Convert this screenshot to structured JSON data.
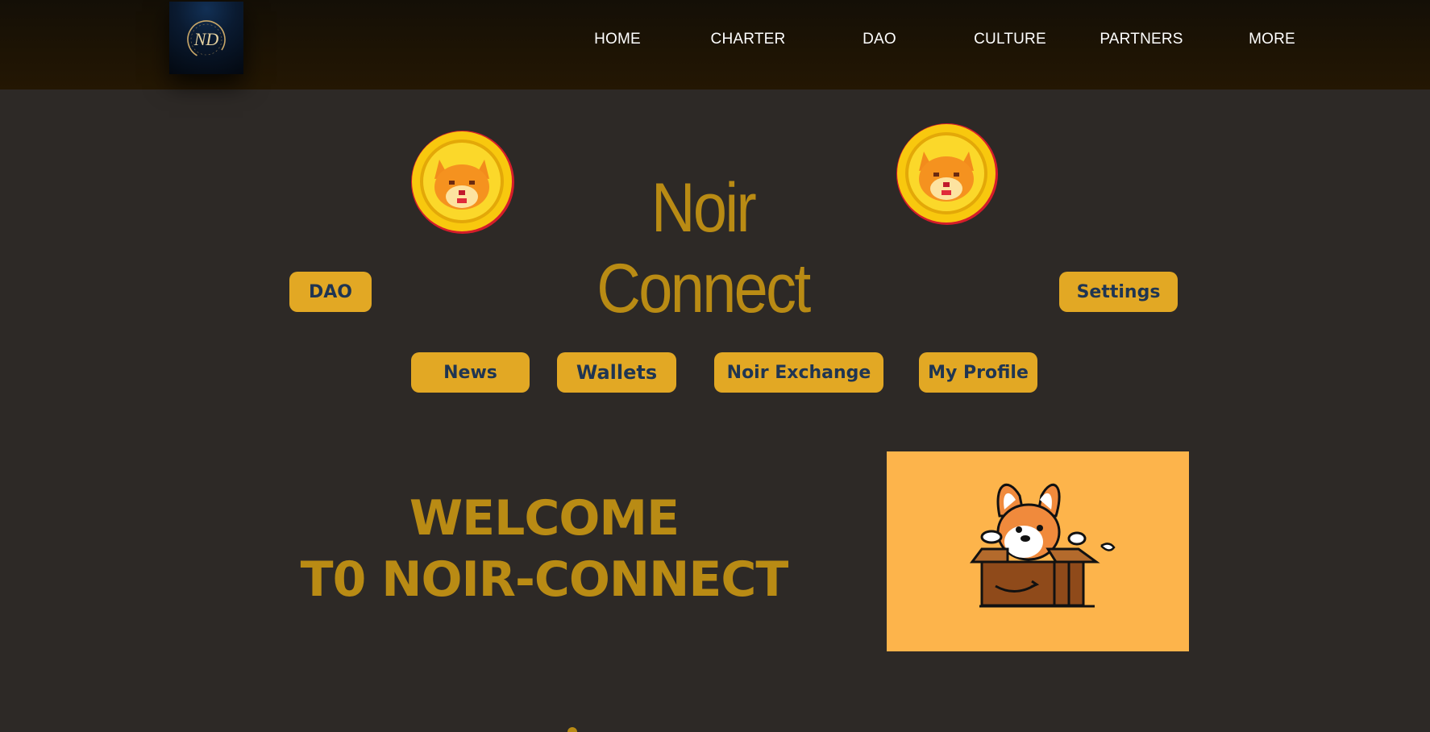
{
  "header": {
    "logo_text": "ND",
    "nav": [
      {
        "label": "HOME"
      },
      {
        "label": "CHARTER"
      },
      {
        "label": "DAO"
      },
      {
        "label": "CULTURE"
      },
      {
        "label": "PARTNERS"
      },
      {
        "label": "MORE"
      }
    ]
  },
  "hero": {
    "title": "Noir Connect",
    "coin_icon": "shiba-coin-icon"
  },
  "buttons": {
    "dao": "DAO",
    "settings": "Settings",
    "news": "News",
    "wallets": "Wallets",
    "noir_exchange": "Noir Exchange",
    "my_profile": "My Profile"
  },
  "welcome": {
    "line1": "WELCOME",
    "line2": "T0 NOIR-CONNECT"
  },
  "image": {
    "name": "corgi-in-box-illustration"
  },
  "colors": {
    "header_bg": "#1a1204",
    "page_bg": "#2d2926",
    "accent_gold": "#b98b14",
    "button_bg": "#e2a824",
    "button_text": "#1f3552",
    "image_bg": "#fdb44b"
  }
}
